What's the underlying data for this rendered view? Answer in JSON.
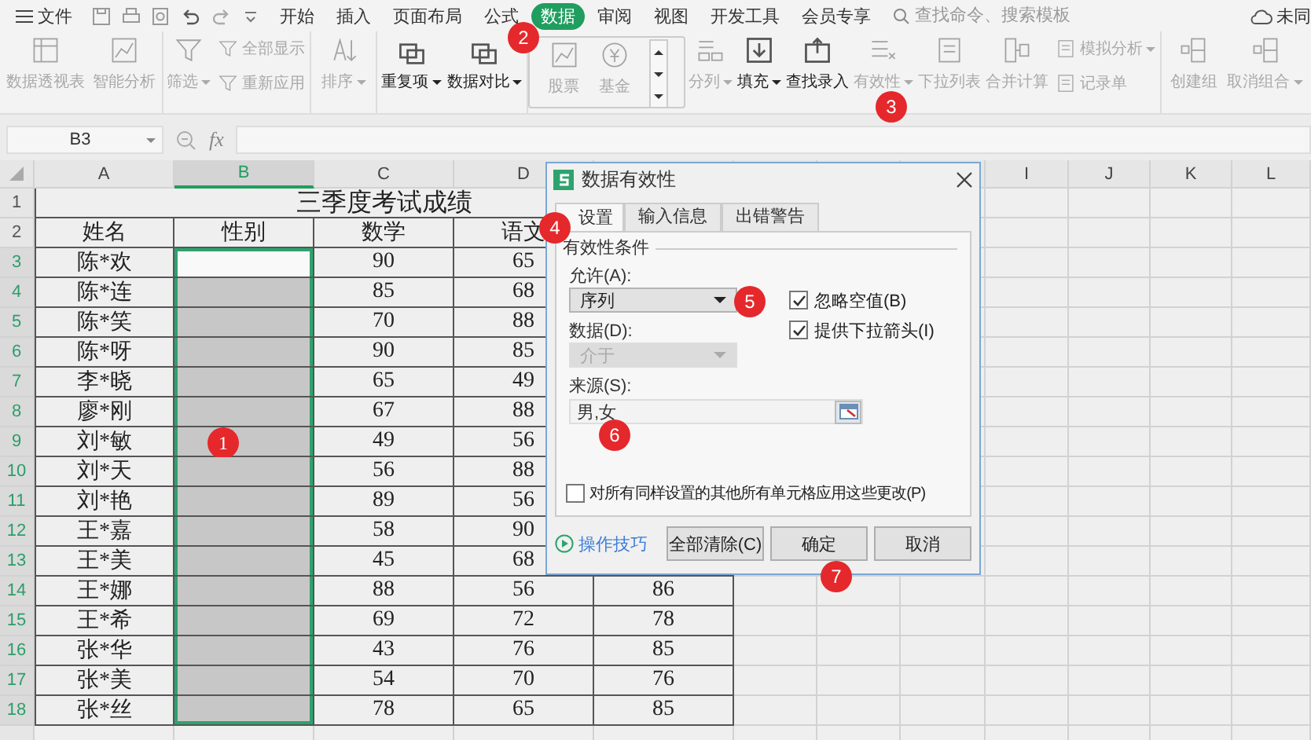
{
  "menu_bar": {
    "file_label": "文件",
    "tabs": [
      {
        "label": "开始",
        "selected": false
      },
      {
        "label": "插入",
        "selected": false
      },
      {
        "label": "页面布局",
        "selected": false
      },
      {
        "label": "公式",
        "selected": false
      },
      {
        "label": "数据",
        "selected": true
      },
      {
        "label": "审阅",
        "selected": false
      },
      {
        "label": "视图",
        "selected": false
      },
      {
        "label": "开发工具",
        "selected": false
      },
      {
        "label": "会员专享",
        "selected": false
      }
    ],
    "search": {
      "placeholder": "查找命令、搜索模板"
    },
    "sync_label": "未同"
  },
  "ribbon": {
    "groups": [
      {
        "kind": "plain",
        "items": [
          {
            "kind": "large",
            "label": "数据透视表",
            "dropdown": false,
            "disabled": true
          },
          {
            "kind": "large",
            "label": "智能分析",
            "dropdown": false,
            "disabled": true
          }
        ]
      },
      {
        "kind": "plain",
        "items": [
          {
            "kind": "large",
            "label": "筛选",
            "dropdown": true,
            "disabled": true
          },
          {
            "kind": "pair",
            "entries": [
              {
                "label": "全部显示",
                "dropdown": false,
                "disabled": true
              },
              {
                "label": "重新应用",
                "dropdown": false,
                "disabled": true
              }
            ]
          }
        ]
      },
      {
        "kind": "plain",
        "items": [
          {
            "kind": "large",
            "label": "排序",
            "dropdown": true,
            "disabled": true
          }
        ]
      },
      {
        "kind": "plain",
        "items": [
          {
            "kind": "large",
            "label": "重复项",
            "dropdown": true,
            "disabled": false
          },
          {
            "kind": "large",
            "label": "数据对比",
            "dropdown": true,
            "disabled": false
          }
        ]
      },
      {
        "kind": "boxed",
        "items": [
          {
            "kind": "large",
            "label": "股票",
            "dropdown": false,
            "disabled": true
          },
          {
            "kind": "large",
            "label": "基金",
            "dropdown": false,
            "disabled": true
          }
        ]
      },
      {
        "kind": "plain",
        "items": [
          {
            "kind": "large",
            "label": "分列",
            "dropdown": true,
            "disabled": true
          },
          {
            "kind": "large",
            "label": "填充",
            "dropdown": true,
            "disabled": false
          },
          {
            "kind": "large",
            "label": "查找录入",
            "dropdown": false,
            "disabled": false
          },
          {
            "kind": "large",
            "label": "有效性",
            "dropdown": true,
            "disabled": true
          },
          {
            "kind": "large",
            "label": "下拉列表",
            "dropdown": false,
            "disabled": true
          },
          {
            "kind": "large",
            "label": "合并计算",
            "dropdown": false,
            "disabled": true
          },
          {
            "kind": "pair",
            "entries": [
              {
                "label": "模拟分析",
                "dropdown": true,
                "disabled": true
              },
              {
                "label": "记录单",
                "dropdown": false,
                "disabled": true
              }
            ]
          }
        ]
      },
      {
        "kind": "plain",
        "items": [
          {
            "kind": "large",
            "label": "创建组",
            "dropdown": false,
            "disabled": true
          },
          {
            "kind": "large",
            "label": "取消组合",
            "dropdown": true,
            "disabled": true
          }
        ]
      }
    ]
  },
  "formula_bar": {
    "name_box": "B3",
    "fx_label": "fx"
  },
  "sheet": {
    "columns": [
      {
        "label": "A",
        "selected": false
      },
      {
        "label": "B",
        "selected": true
      },
      {
        "label": "C",
        "selected": false
      },
      {
        "label": "D",
        "selected": false
      },
      {
        "label": "I",
        "selected": false
      },
      {
        "label": "J",
        "selected": false
      },
      {
        "label": "K",
        "selected": false
      },
      {
        "label": "L",
        "selected": false
      }
    ],
    "rows": [
      {
        "kind": "title",
        "number": "1",
        "title": "三季度考试成绩",
        "selected": false
      },
      {
        "kind": "header",
        "number": "2",
        "cells": [
          "姓名",
          "性别",
          "数学",
          "语文"
        ],
        "selected": false
      },
      {
        "kind": "data",
        "number": "3",
        "name": "陈*欢",
        "math": "90",
        "chinese": "65",
        "selected": true,
        "active": true
      },
      {
        "kind": "data",
        "number": "4",
        "name": "陈*连",
        "math": "85",
        "chinese": "68",
        "selected": true,
        "active": false
      },
      {
        "kind": "data",
        "number": "5",
        "name": "陈*笑",
        "math": "70",
        "chinese": "88",
        "selected": true,
        "active": false
      },
      {
        "kind": "data",
        "number": "6",
        "name": "陈*呀",
        "math": "90",
        "chinese": "85",
        "selected": true,
        "active": false
      },
      {
        "kind": "data",
        "number": "7",
        "name": "李*晓",
        "math": "65",
        "chinese": "49",
        "selected": true,
        "active": false
      },
      {
        "kind": "data",
        "number": "8",
        "name": "廖*刚",
        "math": "67",
        "chinese": "88",
        "selected": true,
        "active": false
      },
      {
        "kind": "data",
        "number": "9",
        "name": "刘*敏",
        "math": "49",
        "chinese": "56",
        "selected": true,
        "active": false
      },
      {
        "kind": "data",
        "number": "10",
        "name": "刘*天",
        "math": "56",
        "chinese": "88",
        "selected": true,
        "active": false
      },
      {
        "kind": "data",
        "number": "11",
        "name": "刘*艳",
        "math": "89",
        "chinese": "56",
        "selected": true,
        "active": false
      },
      {
        "kind": "data",
        "number": "12",
        "name": "王*嘉",
        "math": "58",
        "chinese": "90",
        "selected": true,
        "active": false
      },
      {
        "kind": "data",
        "number": "13",
        "name": "王*美",
        "math": "45",
        "chinese": "68",
        "selected": true,
        "active": false
      },
      {
        "kind": "data",
        "number": "14",
        "name": "王*娜",
        "math": "88",
        "chinese": "56",
        "column_e": "86",
        "selected": true,
        "active": false
      },
      {
        "kind": "data",
        "number": "15",
        "name": "王*希",
        "math": "69",
        "chinese": "72",
        "column_e": "78",
        "selected": true,
        "active": false
      },
      {
        "kind": "data",
        "number": "16",
        "name": "张*华",
        "math": "43",
        "chinese": "76",
        "column_e": "85",
        "selected": true,
        "active": false
      },
      {
        "kind": "data",
        "number": "17",
        "name": "张*美",
        "math": "54",
        "chinese": "70",
        "column_e": "76",
        "selected": true,
        "active": false
      },
      {
        "kind": "data",
        "number": "18",
        "name": "张*丝",
        "math": "78",
        "chinese": "65",
        "column_e": "85",
        "selected": true,
        "active": false
      }
    ]
  },
  "dialog": {
    "title": "数据有效性",
    "tabs": [
      {
        "label": "设置",
        "selected": true
      },
      {
        "label": "输入信息",
        "selected": false
      },
      {
        "label": "出错警告",
        "selected": false
      }
    ],
    "group_title": "有效性条件",
    "allow": {
      "label": "允许(A):",
      "value": "序列",
      "disabled": false
    },
    "data": {
      "label": "数据(D):",
      "value": "介于",
      "disabled": true
    },
    "source": {
      "label": "来源(S):",
      "value": "男,女"
    },
    "checkboxes": [
      {
        "label": "忽略空值(B)",
        "checked": true
      },
      {
        "label": "提供下拉箭头(I)",
        "checked": true
      }
    ],
    "apply_all": {
      "label": "对所有同样设置的其他所有单元格应用这些更改(P)",
      "checked": false
    },
    "tips_link": "操作技巧",
    "buttons": [
      {
        "label": "全部清除(C)"
      },
      {
        "label": "确定"
      },
      {
        "label": "取消"
      }
    ]
  },
  "markers": [
    {
      "label": "1"
    },
    {
      "label": "2"
    },
    {
      "label": "3"
    },
    {
      "label": "4"
    },
    {
      "label": "5"
    },
    {
      "label": "6"
    },
    {
      "label": "7"
    }
  ]
}
